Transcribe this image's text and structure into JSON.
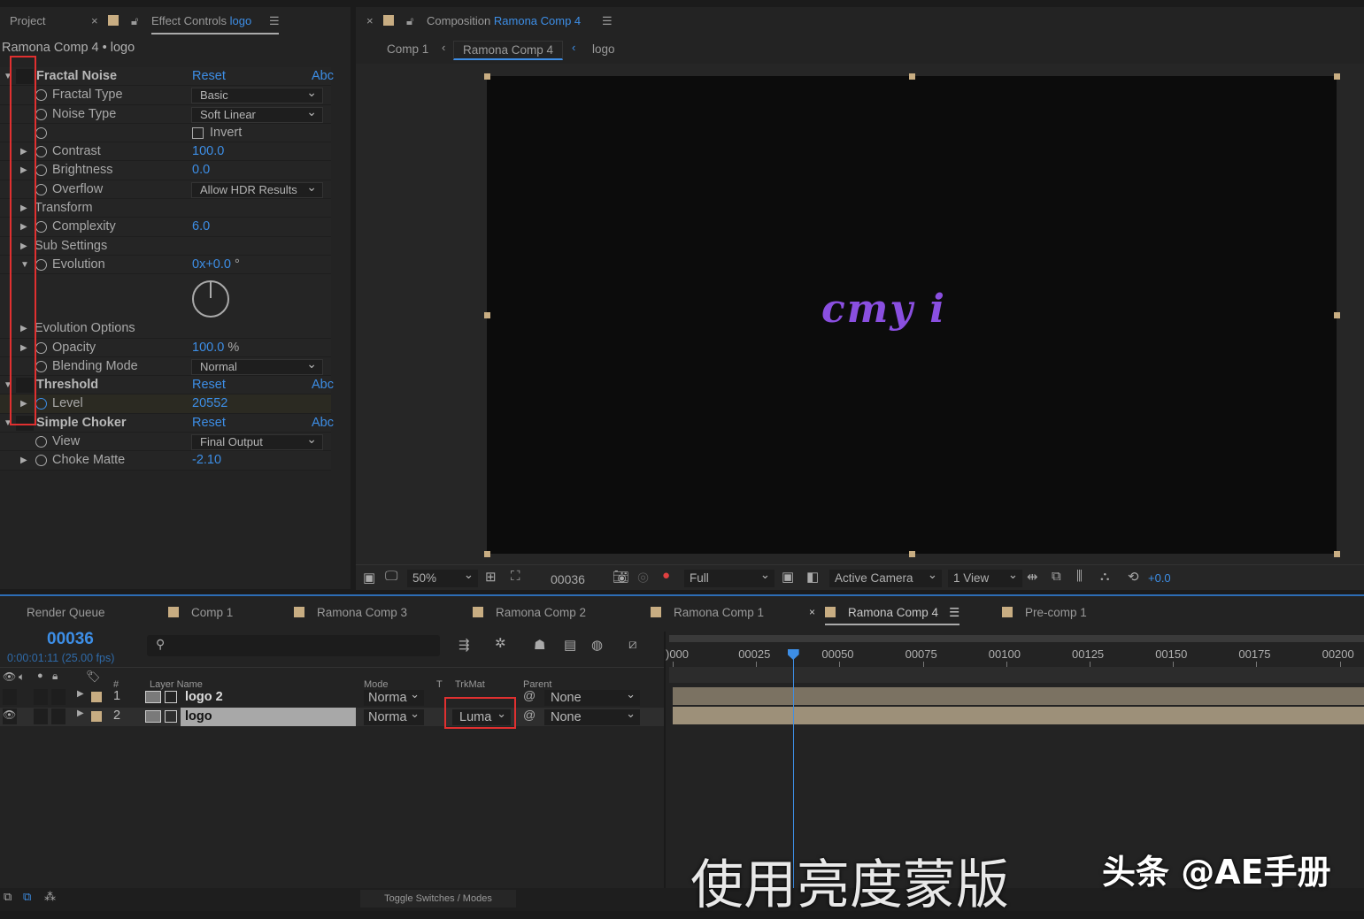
{
  "left_panel": {
    "tab_project": "Project",
    "tab_effect_controls": "Effect Controls",
    "tab_effect_layer": "logo",
    "subtitle": "Ramona Comp 4 • logo",
    "rows": [
      {
        "kind": "group",
        "label": "Fractal Noise",
        "reset": "Reset",
        "abc": "Abc",
        "twirl": "open"
      },
      {
        "kind": "prop",
        "label": "Fractal Type",
        "dropdown": "Basic"
      },
      {
        "kind": "prop",
        "label": "Noise Type",
        "dropdown": "Soft Linear"
      },
      {
        "kind": "prop",
        "label": "",
        "checkbox": "Invert",
        "checked": false
      },
      {
        "kind": "prop",
        "label": "Contrast",
        "value": "100.0",
        "twirl": "closed"
      },
      {
        "kind": "prop",
        "label": "Brightness",
        "value": "0.0",
        "twirl": "closed"
      },
      {
        "kind": "prop",
        "label": "Overflow",
        "dropdown": "Allow HDR Results"
      },
      {
        "kind": "prop",
        "label": "Transform",
        "twirl": "closed",
        "nostop": true
      },
      {
        "kind": "prop",
        "label": "Complexity",
        "value": "6.0",
        "twirl": "closed"
      },
      {
        "kind": "prop",
        "label": "Sub Settings",
        "twirl": "closed",
        "nostop": true
      },
      {
        "kind": "prop",
        "label": "Evolution",
        "value": "0x+0.0",
        "unit": "°",
        "twirl": "open",
        "dial": true
      },
      {
        "kind": "prop",
        "label": "Evolution Options",
        "twirl": "closed",
        "nostop": true
      },
      {
        "kind": "prop",
        "label": "Opacity",
        "value": "100.0",
        "unit": "%",
        "twirl": "closed"
      },
      {
        "kind": "prop",
        "label": "Blending Mode",
        "dropdown": "Normal"
      },
      {
        "kind": "group",
        "label": "Threshold",
        "reset": "Reset",
        "abc": "Abc",
        "twirl": "open"
      },
      {
        "kind": "prop",
        "label": "Level",
        "value": "20552",
        "twirl": "closed",
        "active": true
      },
      {
        "kind": "group",
        "label": "Simple Choker",
        "reset": "Reset",
        "abc": "Abc",
        "twirl": "open"
      },
      {
        "kind": "prop",
        "label": "View",
        "dropdown": "Final Output"
      },
      {
        "kind": "prop",
        "label": "Choke Matte",
        "value": "-2.10",
        "twirl": "closed"
      }
    ]
  },
  "composition": {
    "tab_label": "Composition",
    "tab_comp": "Ramona Comp 4",
    "breadcrumbs": [
      "Comp 1",
      "Ramona Comp 4",
      "logo"
    ],
    "canvas_text": "cmy i",
    "toolbar": {
      "zoom": "50%",
      "timecode": "00036",
      "resolution": "Full",
      "camera": "Active Camera",
      "views": "1 View",
      "exposure": "+0.0"
    }
  },
  "timeline": {
    "tabs": [
      "Render Queue",
      "Comp 1",
      "Ramona Comp 3",
      "Ramona Comp 2",
      "Ramona Comp 1",
      "Ramona Comp 4",
      "Pre-comp 1"
    ],
    "active_tab": "Ramona Comp 4",
    "current_frame": "00036",
    "current_time": "0:00:01:11 (25.00 fps)",
    "search_placeholder": "",
    "headers": {
      "num": "#",
      "layer_name": "Layer Name",
      "mode": "Mode",
      "t": "T",
      "trkmat": "TrkMat",
      "parent": "Parent"
    },
    "layers": [
      {
        "num": "1",
        "name": "logo 2",
        "mode": "Norma",
        "trkmat": "",
        "parent": "None",
        "visible": false,
        "selected": false
      },
      {
        "num": "2",
        "name": "logo",
        "mode": "Norma",
        "trkmat": "Luma",
        "parent": "None",
        "visible": true,
        "selected": true
      }
    ],
    "ruler_ticks": [
      ")000",
      "00025",
      "00050",
      "00075",
      "00100",
      "00125",
      "00150",
      "00175",
      "00200"
    ],
    "playhead_frame": 36,
    "footer": "Toggle Switches / Modes"
  },
  "watermark": {
    "caption": "使用亮度蒙版",
    "brand": "头条 @AE手册"
  },
  "colors": {
    "accent": "#3d8ee6",
    "label_swatch": "#c8ad82",
    "highlight": "#e03030",
    "noise": "#8a4fe0"
  }
}
